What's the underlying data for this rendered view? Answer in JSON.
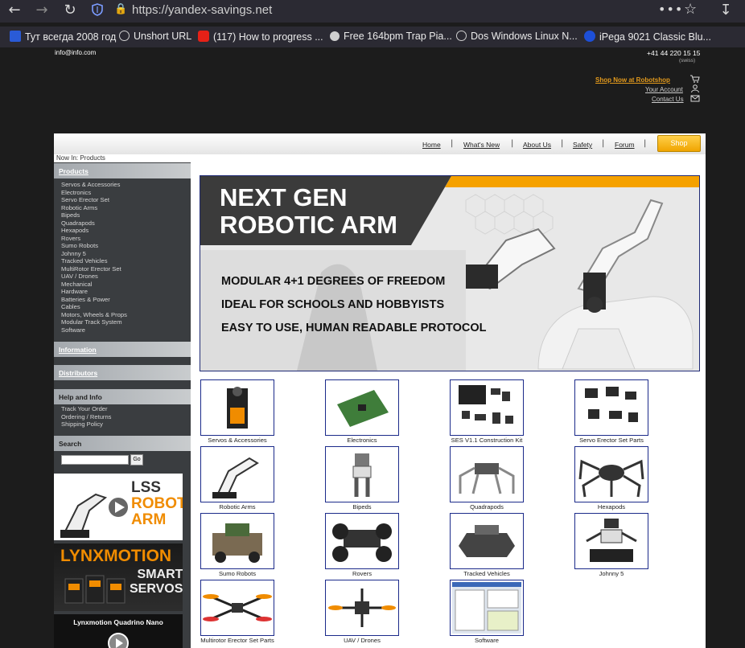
{
  "browser": {
    "url": "https://yandex-savings.net",
    "bookmarks": [
      {
        "label": "Тут всегда 2008 год",
        "color": "#2a5bd7"
      },
      {
        "label": "Unshort URL",
        "color": "#cfcfcf"
      },
      {
        "label": "(117) How to progress ...",
        "color": "#e62117"
      },
      {
        "label": "Free 164bpm Trap Pia...",
        "color": "#cfcfcf"
      },
      {
        "label": "Dos Windows Linux N...",
        "color": "#cfcfcf"
      },
      {
        "label": "iPega 9021 Classic Blu...",
        "color": "#1d4fd8"
      }
    ]
  },
  "header": {
    "email": "info@info.com",
    "phone": "+41 44 220 15 15",
    "phone_note": "(swiss)",
    "shop_now": "Shop Now at Robotshop",
    "your_account": "Your Account",
    "contact_us": "Contact Us"
  },
  "nav": {
    "items": [
      "Home",
      "What's New",
      "About Us",
      "Safety",
      "Forum"
    ],
    "shop": "Shop",
    "now_in": "Now In: Products"
  },
  "sidebar": {
    "products_title": "Products",
    "products": [
      "Servos & Accessories",
      "Electronics",
      "Servo Erector Set",
      "Robotic Arms",
      "Bipeds",
      "Quadrapods",
      "Hexapods",
      "Rovers",
      "Sumo Robots",
      "Johnny 5",
      "Tracked Vehicles",
      "MultiRotor Erector Set",
      "UAV / Drones",
      "Mechanical",
      "Hardware",
      "Batteries & Power",
      "Cables",
      "Motors, Wheels & Props",
      "Modular Track System",
      "Software"
    ],
    "information": "Information",
    "distributors": "Distributors",
    "help_title": "Help and Info",
    "help_links": [
      "Track Your Order",
      "Ordering / Returns",
      "Shipping Policy"
    ],
    "search_title": "Search",
    "search_go": "Go",
    "promo1": [
      "LSS",
      "ROBOTIC",
      "ARM"
    ],
    "promo2": [
      "LYNXMOTION",
      "SMART",
      "SERVOS"
    ],
    "promo3": "Lynxmotion Quadrino Nano"
  },
  "banner": {
    "title_line1": "NEXT GEN",
    "title_line2": "ROBOTIC ARM",
    "bullets": [
      "MODULAR 4+1 DEGREES OF FREEDOM",
      "IDEAL FOR SCHOOLS AND HOBBYISTS",
      "EASY TO USE, HUMAN READABLE PROTOCOL"
    ]
  },
  "categories": [
    "Servos & Accessories",
    "Electronics",
    "SES V1.1 Construction Kit",
    "Servo Erector Set Parts",
    "Robotic Arms",
    "Bipeds",
    "Quadrapods",
    "Hexapods",
    "Sumo Robots",
    "Rovers",
    "Tracked Vehicles",
    "Johnny 5",
    "Multirotor Erector Set Parts",
    "UAV / Drones",
    "Software"
  ]
}
